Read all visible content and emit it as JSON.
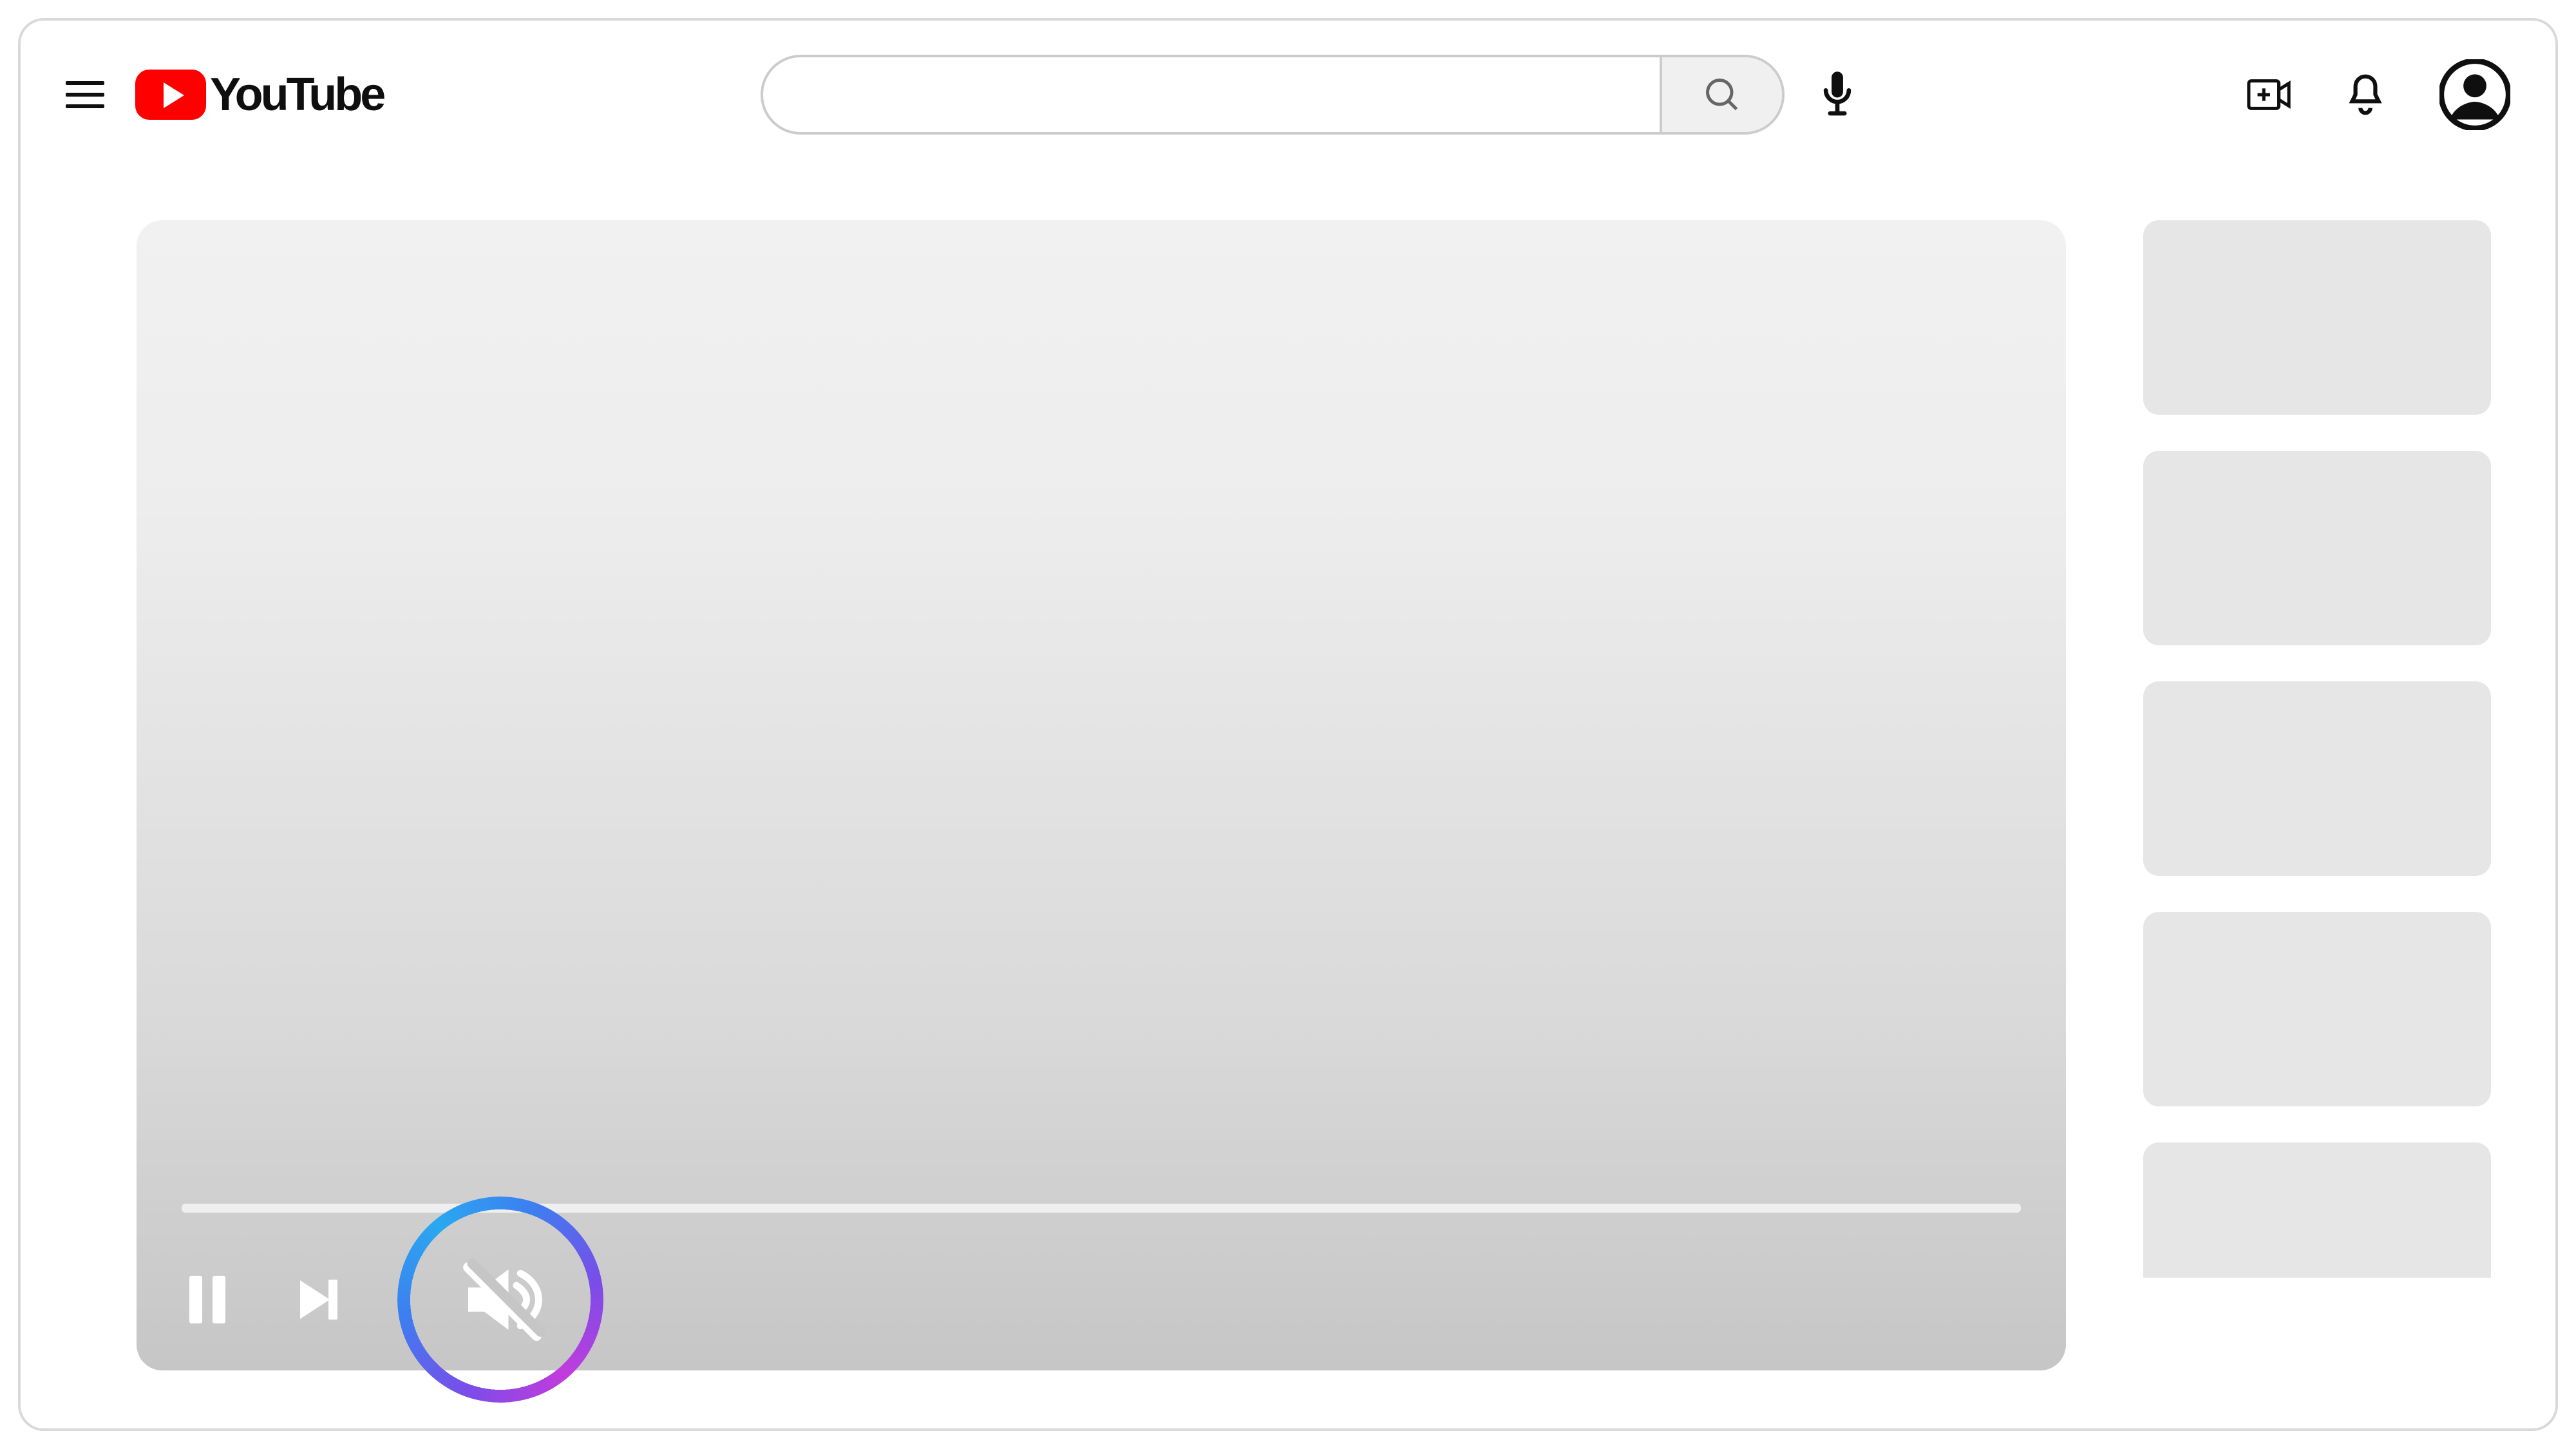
{
  "brand": {
    "name": "YouTube"
  },
  "search": {
    "value": "",
    "placeholder": ""
  },
  "header_icons": {
    "menu": "hamburger-menu-icon",
    "mic": "microphone-icon",
    "create": "create-video-icon",
    "notifications": "notifications-bell-icon",
    "avatar": "user-avatar-icon",
    "search": "search-icon"
  },
  "player": {
    "controls": {
      "pause": "pause-icon",
      "next": "next-track-icon",
      "mute": "volume-muted-icon"
    },
    "muted": true,
    "highlighted_control": "mute"
  },
  "recommendations": {
    "count": 5
  },
  "colors": {
    "brand_red": "#ff0000",
    "placeholder_grey": "#e6e6e6",
    "ring_gradient": [
      "#c23bdc",
      "#3d7ef0",
      "#2aa8f0"
    ]
  }
}
